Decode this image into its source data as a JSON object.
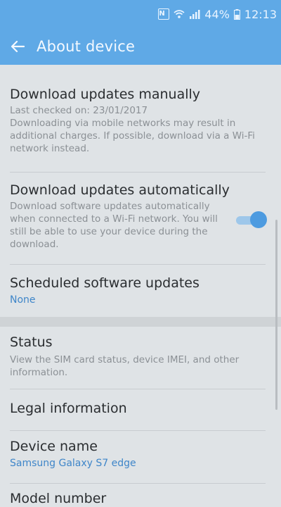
{
  "status_bar": {
    "icons": [
      "nfc-icon",
      "wifi-icon",
      "signal-icon",
      "battery-icon"
    ],
    "battery": "44%",
    "time": "12:13",
    "nfc_letter": "N"
  },
  "app_bar": {
    "title": "About device",
    "back_icon": "arrow-left-icon"
  },
  "items": {
    "manual": {
      "title": "Download updates manually",
      "desc1": "Last checked on: 23/01/2017",
      "desc2": "Downloading via mobile networks may result in additional charges. If possible, download via a Wi-Fi network instead."
    },
    "auto": {
      "title": "Download updates automatically",
      "desc": "Download software updates automatically when connected to a Wi-Fi network. You will still be able to use your device during the download.",
      "toggle_on": true
    },
    "scheduled": {
      "title": "Scheduled software updates",
      "value": "None"
    },
    "status": {
      "title": "Status",
      "desc": "View the SIM card status, device IMEI, and other information."
    },
    "legal": {
      "title": "Legal information"
    },
    "device_name": {
      "title": "Device name",
      "value": "Samsung Galaxy S7 edge"
    },
    "model": {
      "title": "Model number"
    }
  },
  "colors": {
    "accent": "#5fa9e6",
    "toggle": "#4d9be0",
    "link": "#3f86c9"
  }
}
